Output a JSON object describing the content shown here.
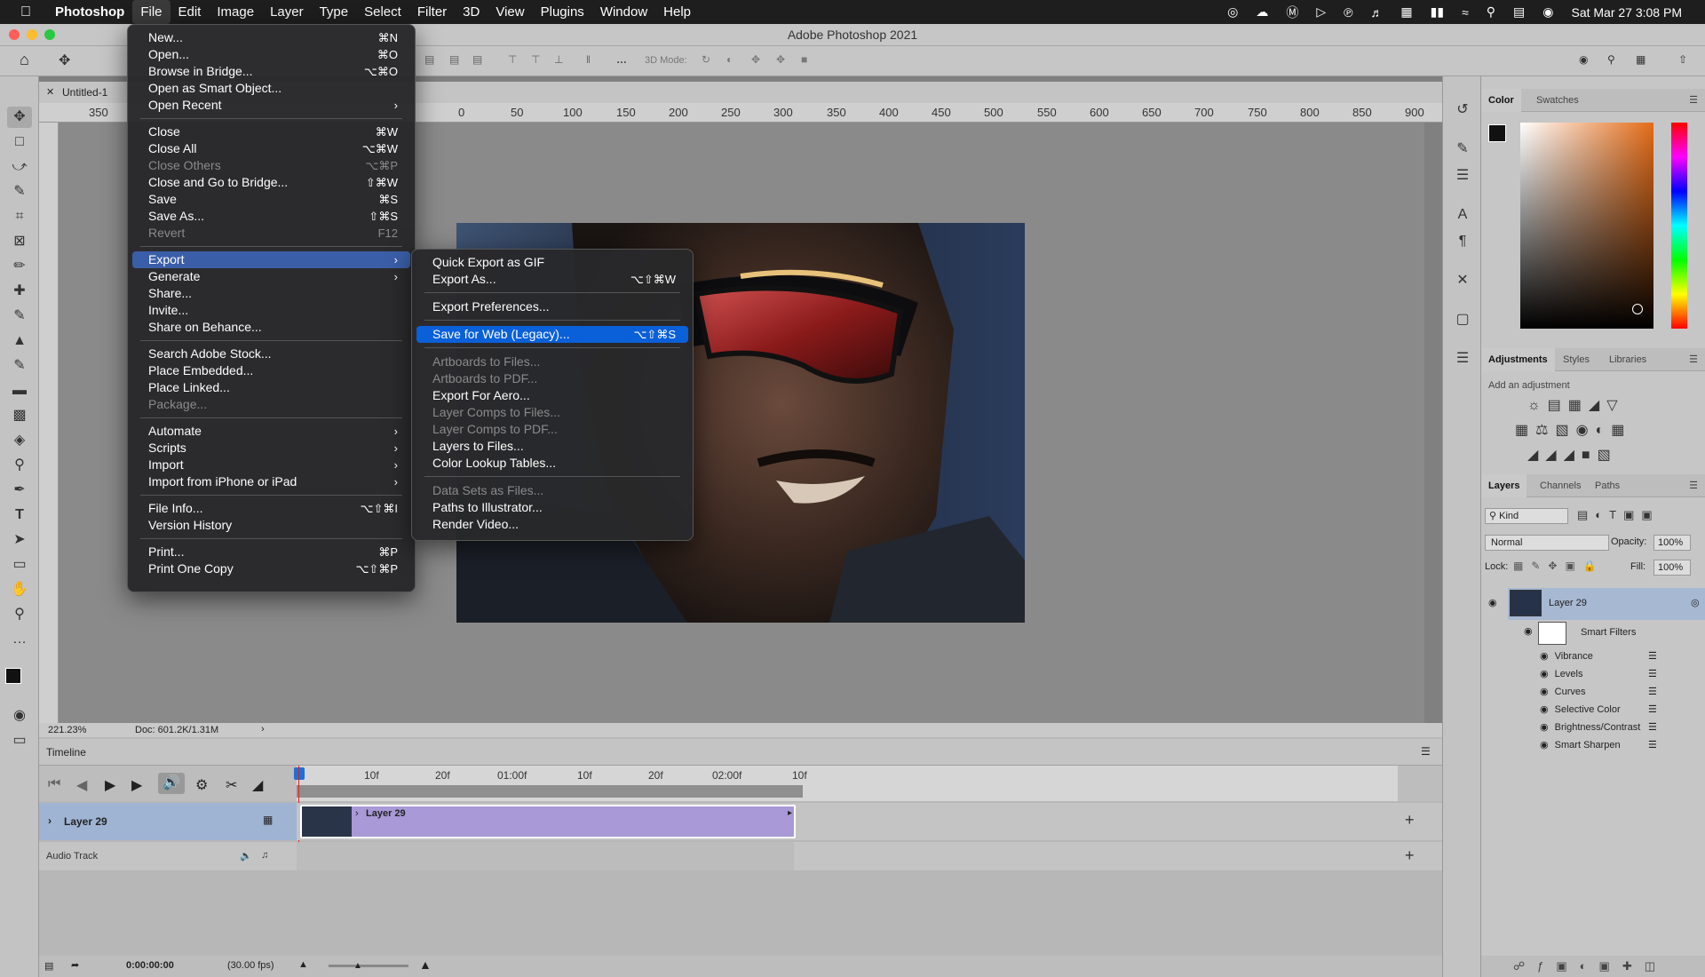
{
  "menubar": {
    "app": "Photoshop",
    "items": [
      "File",
      "Edit",
      "Image",
      "Layer",
      "Type",
      "Select",
      "Filter",
      "3D",
      "View",
      "Plugins",
      "Window",
      "Help"
    ],
    "clock": "Sat Mar 27  3:08 PM"
  },
  "window": {
    "title": "Adobe Photoshop 2021"
  },
  "options": {
    "mode3d": "3D Mode:"
  },
  "document": {
    "tab": "Untitled-1",
    "zoom": "221.23%",
    "doc_size": "Doc: 601.2K/1.31M"
  },
  "ruler": [
    "350",
    "0",
    "50",
    "100",
    "150",
    "200",
    "250",
    "300",
    "350",
    "400",
    "450",
    "500",
    "550",
    "600",
    "650",
    "700",
    "750",
    "800",
    "850",
    "900"
  ],
  "file_menu": [
    {
      "label": "New...",
      "shortcut": "⌘N"
    },
    {
      "label": "Open...",
      "shortcut": "⌘O"
    },
    {
      "label": "Browse in Bridge...",
      "shortcut": "⌥⌘O"
    },
    {
      "label": "Open as Smart Object...",
      "shortcut": ""
    },
    {
      "label": "Open Recent",
      "shortcut": "›"
    },
    {
      "label": "Close",
      "shortcut": "⌘W"
    },
    {
      "label": "Close All",
      "shortcut": "⌥⌘W"
    },
    {
      "label": "Close Others",
      "shortcut": "⌥⌘P"
    },
    {
      "label": "Close and Go to Bridge...",
      "shortcut": "⇧⌘W"
    },
    {
      "label": "Save",
      "shortcut": "⌘S"
    },
    {
      "label": "Save As...",
      "shortcut": "⇧⌘S"
    },
    {
      "label": "Revert",
      "shortcut": "F12"
    },
    {
      "label": "Export",
      "shortcut": "›"
    },
    {
      "label": "Generate",
      "shortcut": "›"
    },
    {
      "label": "Share...",
      "shortcut": ""
    },
    {
      "label": "Invite...",
      "shortcut": ""
    },
    {
      "label": "Share on Behance...",
      "shortcut": ""
    },
    {
      "label": "Search Adobe Stock...",
      "shortcut": ""
    },
    {
      "label": "Place Embedded...",
      "shortcut": ""
    },
    {
      "label": "Place Linked...",
      "shortcut": ""
    },
    {
      "label": "Package...",
      "shortcut": ""
    },
    {
      "label": "Automate",
      "shortcut": "›"
    },
    {
      "label": "Scripts",
      "shortcut": "›"
    },
    {
      "label": "Import",
      "shortcut": "›"
    },
    {
      "label": "Import from iPhone or iPad",
      "shortcut": "›"
    },
    {
      "label": "File Info...",
      "shortcut": "⌥⇧⌘I"
    },
    {
      "label": "Version History",
      "shortcut": ""
    },
    {
      "label": "Print...",
      "shortcut": "⌘P"
    },
    {
      "label": "Print One Copy",
      "shortcut": "⌥⇧⌘P"
    }
  ],
  "export_menu": [
    {
      "label": "Quick Export as GIF",
      "shortcut": ""
    },
    {
      "label": "Export As...",
      "shortcut": "⌥⇧⌘W"
    },
    {
      "label": "Export Preferences...",
      "shortcut": ""
    },
    {
      "label": "Save for Web (Legacy)...",
      "shortcut": "⌥⇧⌘S"
    },
    {
      "label": "Artboards to Files...",
      "shortcut": ""
    },
    {
      "label": "Artboards to PDF...",
      "shortcut": ""
    },
    {
      "label": "Export For Aero...",
      "shortcut": ""
    },
    {
      "label": "Layer Comps to Files...",
      "shortcut": ""
    },
    {
      "label": "Layer Comps to PDF...",
      "shortcut": ""
    },
    {
      "label": "Layers to Files...",
      "shortcut": ""
    },
    {
      "label": "Color Lookup Tables...",
      "shortcut": ""
    },
    {
      "label": "Data Sets as Files...",
      "shortcut": ""
    },
    {
      "label": "Paths to Illustrator...",
      "shortcut": ""
    },
    {
      "label": "Render Video...",
      "shortcut": ""
    }
  ],
  "timeline": {
    "title": "Timeline",
    "ticks": [
      "10f",
      "20f",
      "01:00f",
      "10f",
      "20f",
      "02:00f",
      "10f"
    ],
    "track": "Layer 29",
    "clip": "Layer 29",
    "audio": "Audio Track",
    "timecode": "0:00:00:00",
    "fps": "(30.00 fps)"
  },
  "panels": {
    "color_tabs": [
      "Color",
      "Swatches"
    ],
    "adj_tabs": [
      "Adjustments",
      "Styles",
      "Libraries"
    ],
    "adj_hint": "Add an adjustment",
    "layer_tabs": [
      "Layers",
      "Channels",
      "Paths"
    ],
    "kind": "Kind",
    "blend": "Normal",
    "opacity_label": "Opacity:",
    "opacity": "100%",
    "lock_label": "Lock:",
    "fill_label": "Fill:",
    "fill": "100%",
    "layer_name": "Layer 29",
    "smart_filters": "Smart Filters",
    "filters": [
      "Vibrance",
      "Levels",
      "Curves",
      "Selective Color",
      "Brightness/Contrast",
      "Smart Sharpen"
    ]
  },
  "colors": {
    "accent": "#0a60d8",
    "clip": "#a999d6",
    "track_label": "#9fb4d3"
  }
}
